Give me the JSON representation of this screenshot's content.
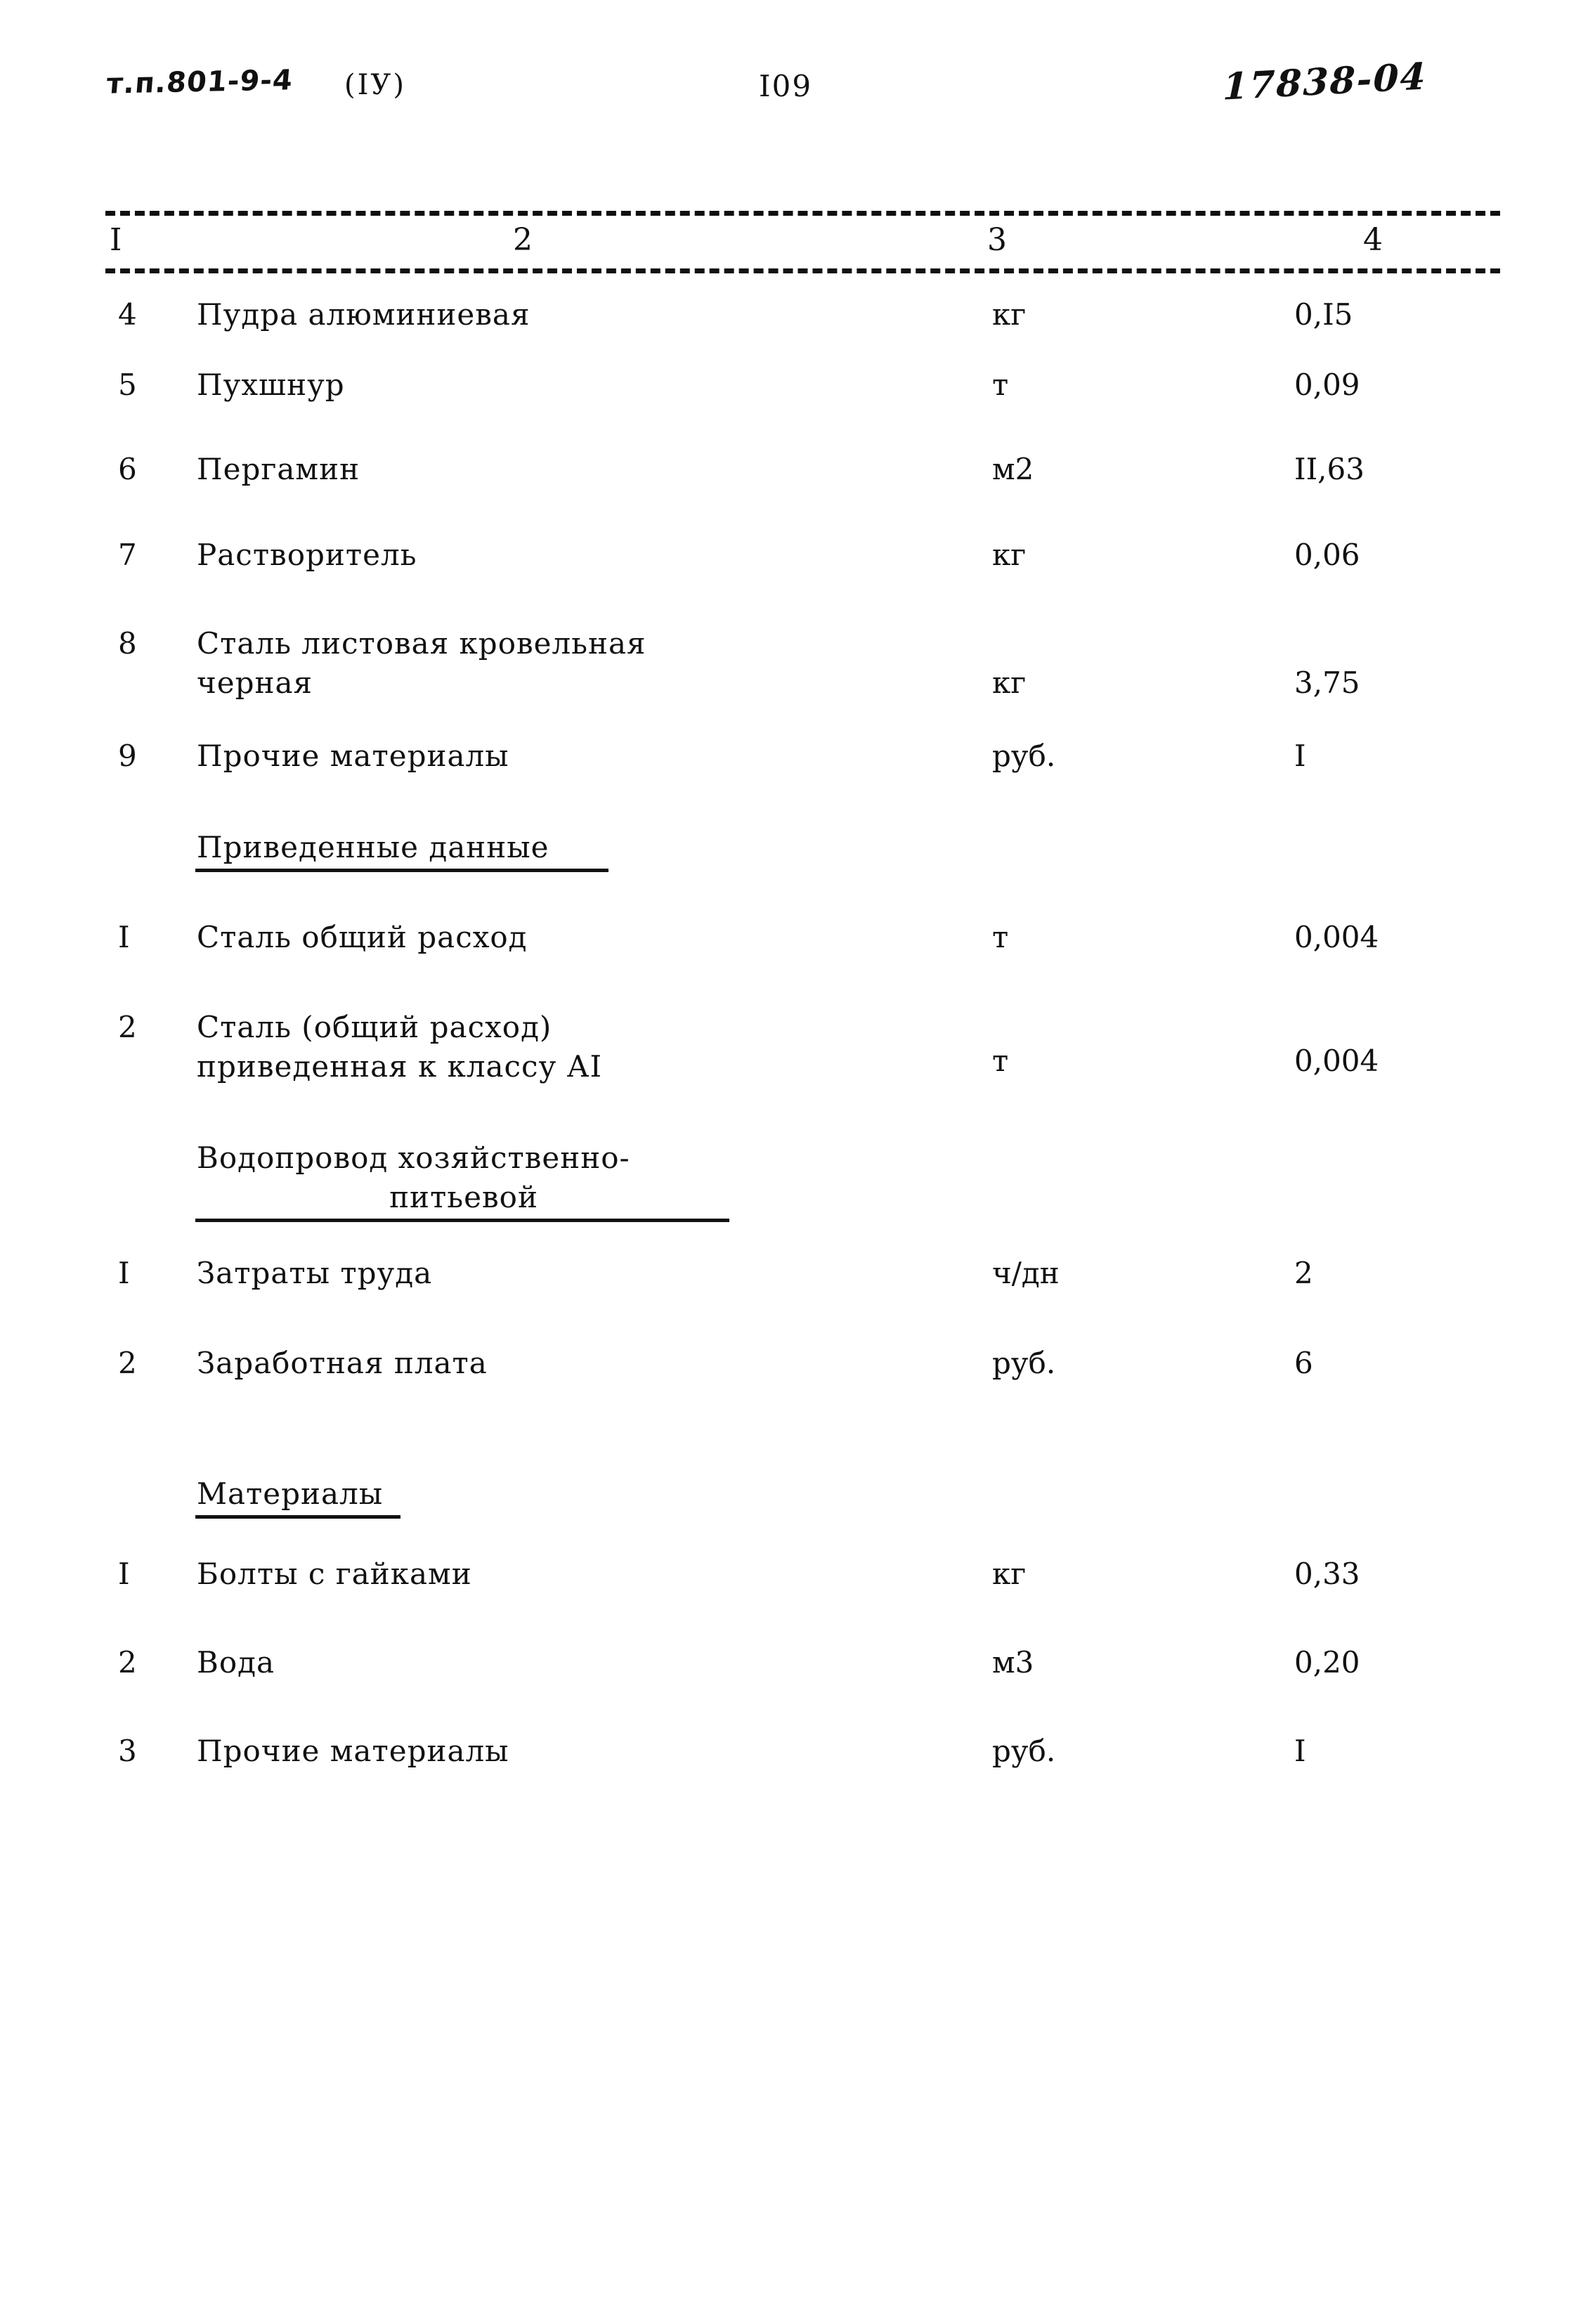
{
  "header": {
    "doc_code": "т.п.801-9-4",
    "doc_variant": "(IУ)",
    "page_number": "I09",
    "archive_code": "17838-04"
  },
  "table": {
    "column_headers": [
      "I",
      "2",
      "3",
      "4"
    ],
    "rows": [
      {
        "num": "4",
        "name": "Пудра алюминиевая",
        "unit": "кг",
        "value": "0,I5"
      },
      {
        "num": "5",
        "name": "Пухшнур",
        "unit": "т",
        "value": "0,09"
      },
      {
        "num": "6",
        "name": "Пергамин",
        "unit": "м2",
        "value": "II,63"
      },
      {
        "num": "7",
        "name": "Растворитель",
        "unit": "кг",
        "value": "0,06"
      },
      {
        "num": "8",
        "name": "Сталь листовая кровельная\nчерная",
        "unit": "кг",
        "value": "3,75"
      },
      {
        "num": "9",
        "name": "Прочие материалы",
        "unit": "руб.",
        "value": "I"
      }
    ],
    "section_privedennye": {
      "title": "Приведенные данные",
      "rows": [
        {
          "num": "I",
          "name": "Сталь общий расход",
          "unit": "т",
          "value": "0,004"
        },
        {
          "num": "2",
          "name": "Сталь (общий расход)\nприведенная к классу АI",
          "unit": "т",
          "value": "0,004"
        }
      ]
    },
    "section_vodoprovod": {
      "title_line1": "Водопровод хозяйственно-",
      "title_line2": "питьевой",
      "rows": [
        {
          "num": "I",
          "name": "Затраты труда",
          "unit": "ч/дн",
          "value": "2"
        },
        {
          "num": "2",
          "name": "Заработная плата",
          "unit": "руб.",
          "value": "6"
        }
      ]
    },
    "section_materialy": {
      "title": "Материалы",
      "rows": [
        {
          "num": "I",
          "name": "Болты с гайками",
          "unit": "кг",
          "value": "0,33"
        },
        {
          "num": "2",
          "name": "Вода",
          "unit": "м3",
          "value": "0,20"
        },
        {
          "num": "3",
          "name": "Прочие материалы",
          "unit": "руб.",
          "value": "I"
        }
      ]
    }
  }
}
